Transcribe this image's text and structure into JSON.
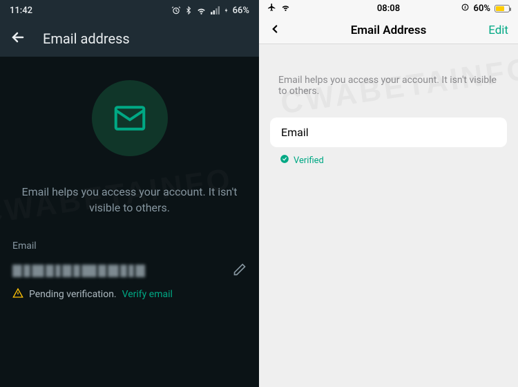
{
  "left": {
    "statusbar": {
      "time": "11:42",
      "battery": "66%"
    },
    "header": {
      "title": "Email address"
    },
    "help_text": "Email helps you access your account. It isn't visible to others.",
    "email_label": "Email",
    "pending_text": "Pending verification.",
    "verify_link": "Verify email"
  },
  "right": {
    "statusbar": {
      "time": "08:08",
      "battery": "60%"
    },
    "header": {
      "title": "Email Address",
      "edit": "Edit"
    },
    "help_text": "Email helps you access your account. It isn't visible to others.",
    "email_label": "Email",
    "verified": "Verified"
  },
  "colors": {
    "accent": "#00a884",
    "warning": "#ffc107"
  },
  "watermark": "CWABETAINFO"
}
